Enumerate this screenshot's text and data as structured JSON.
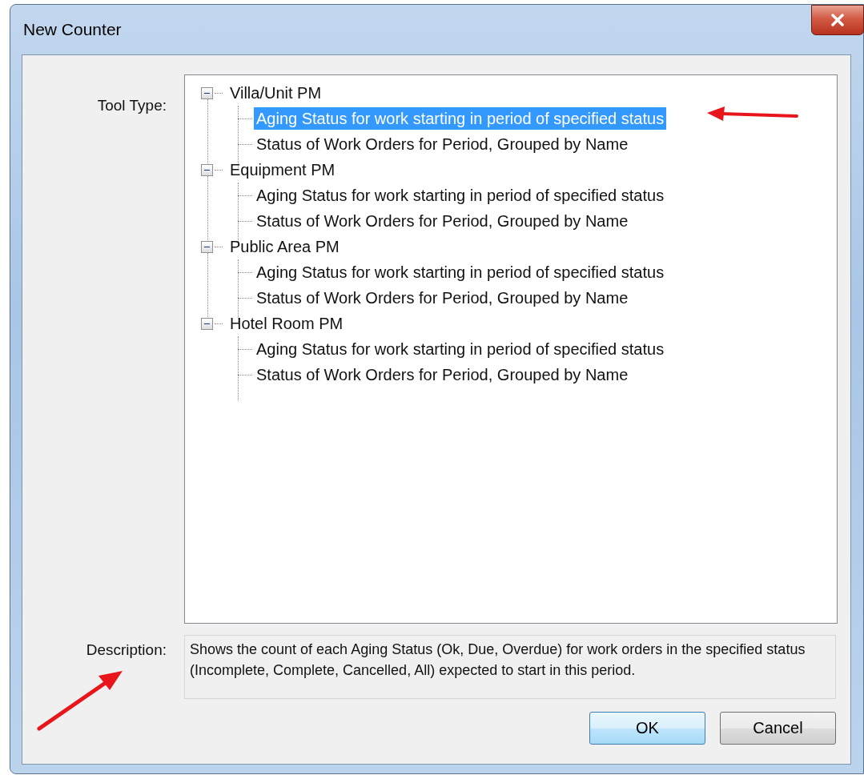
{
  "window": {
    "title": "New Counter"
  },
  "tool_type": {
    "label": "Tool Type:",
    "tree": [
      {
        "label": "Villa/Unit PM",
        "expanded": true,
        "children": [
          {
            "label": "Aging Status for work starting in period of specified status",
            "selected": true
          },
          {
            "label": "Status of Work Orders for Period, Grouped by Name",
            "selected": false
          }
        ]
      },
      {
        "label": "Equipment PM",
        "expanded": true,
        "children": [
          {
            "label": "Aging Status for work starting in period of specified status",
            "selected": false
          },
          {
            "label": "Status of Work Orders for Period, Grouped by Name",
            "selected": false
          }
        ]
      },
      {
        "label": "Public Area PM",
        "expanded": true,
        "children": [
          {
            "label": "Aging Status for work starting in period of specified status",
            "selected": false
          },
          {
            "label": "Status of Work Orders for Period, Grouped by Name",
            "selected": false
          }
        ]
      },
      {
        "label": "Hotel Room PM",
        "expanded": true,
        "children": [
          {
            "label": "Aging Status for work starting in period of specified status",
            "selected": false
          },
          {
            "label": "Status of Work Orders for Period, Grouped by Name",
            "selected": false
          }
        ]
      }
    ]
  },
  "description": {
    "label": "Description:",
    "text": "Shows the count of each Aging Status (Ok, Due, Overdue) for work orders in the specified status (Incomplete, Complete, Cancelled, All) expected to start in this period."
  },
  "buttons": [
    {
      "label": "OK",
      "default": true
    },
    {
      "label": "Cancel",
      "default": false
    }
  ]
}
